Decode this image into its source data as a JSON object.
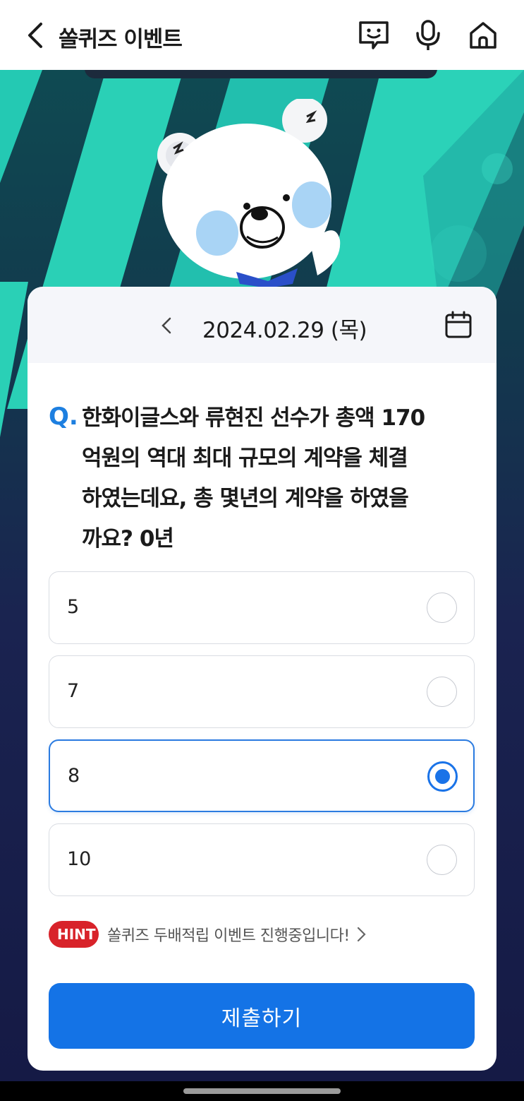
{
  "header": {
    "title": "쏠퀴즈 이벤트",
    "icons": [
      "back-icon",
      "chat-bot-icon",
      "mic-icon",
      "home-icon"
    ]
  },
  "card": {
    "date": "2024.02.29 (목)",
    "question_prefix": "Q.",
    "question": "한화이글스와 류현진 선수가 총액 170억원의 역대 최대 규모의 계약을 체결하였는데요, 총 몇년의 계약을 하였을까요? 0년",
    "question_lines": [
      "한화이글스와 류현진 선수가 총액 170",
      "억원의 역대 최대 규모의 계약을 체결",
      "하였는데요, 총 몇년의 계약을 하였을",
      "까요? 0년"
    ],
    "options": [
      {
        "label": "5",
        "selected": false
      },
      {
        "label": "7",
        "selected": false
      },
      {
        "label": "8",
        "selected": true
      },
      {
        "label": "10",
        "selected": false
      }
    ],
    "hint_badge": "HINT",
    "hint_text": "쏠퀴즈 두배적립 이벤트 진행중입니다!",
    "submit_label": "제출하기"
  },
  "colors": {
    "accent": "#1473e6",
    "hint": "#d8232a",
    "banner_stripe": "#2ad0b6",
    "banner_dark": "#151a45"
  }
}
